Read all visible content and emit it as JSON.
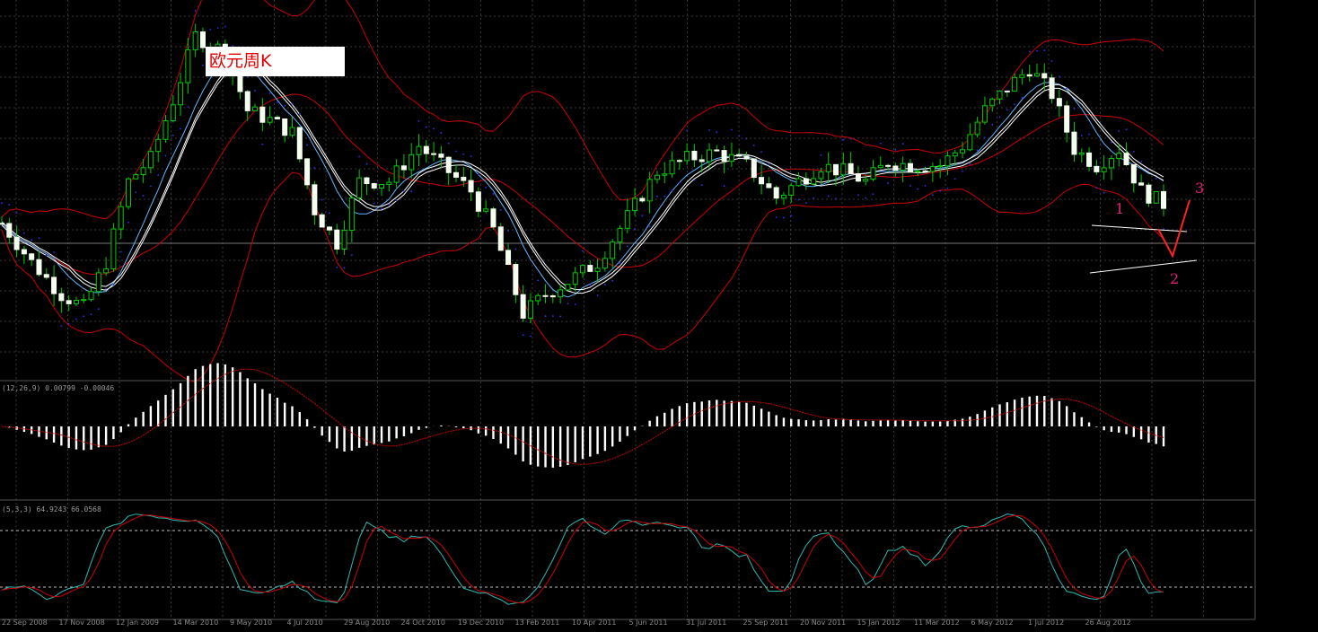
{
  "chart_data": {
    "type": "candlestick",
    "title": "欧元周K",
    "subtitle": "",
    "xlabel": "",
    "ylabel": "",
    "grid": true,
    "x_ticks": [
      "22 Sep 2008",
      "17 Nov 2008",
      "12 Jan 2009",
      "14 Mar 2010",
      "9 May 2010",
      "4 Jul 2010",
      "29 Aug 2010",
      "24 Oct 2010",
      "19 Dec 2010",
      "13 Feb 2011",
      "10 Apr 2011",
      "5 Jun 2011",
      "31 Jul 2011",
      "25 Sep 2011",
      "20 Nov 2011",
      "15 Jan 2012",
      "11 Mar 2012",
      "6 May 2012",
      "1 Jul 2012",
      "26 Aug 2012"
    ],
    "price_path_norm": [
      [
        0,
        0.42
      ],
      [
        4,
        0.3
      ],
      [
        8,
        0.2
      ],
      [
        11,
        0.16
      ],
      [
        14,
        0.3
      ],
      [
        17,
        0.55
      ],
      [
        20,
        0.62
      ],
      [
        23,
        0.8
      ],
      [
        26,
        1.0
      ],
      [
        30,
        0.95
      ],
      [
        33,
        0.77
      ],
      [
        36,
        0.74
      ],
      [
        39,
        0.7
      ],
      [
        42,
        0.46
      ],
      [
        45,
        0.36
      ],
      [
        48,
        0.55
      ],
      [
        52,
        0.55
      ],
      [
        56,
        0.66
      ],
      [
        60,
        0.58
      ],
      [
        63,
        0.52
      ],
      [
        66,
        0.4
      ],
      [
        70,
        0.14
      ],
      [
        73,
        0.2
      ],
      [
        76,
        0.24
      ],
      [
        80,
        0.3
      ],
      [
        84,
        0.44
      ],
      [
        88,
        0.58
      ],
      [
        92,
        0.62
      ],
      [
        96,
        0.64
      ],
      [
        100,
        0.6
      ],
      [
        104,
        0.5
      ],
      [
        107,
        0.55
      ],
      [
        110,
        0.6
      ],
      [
        113,
        0.58
      ],
      [
        116,
        0.55
      ],
      [
        119,
        0.61
      ],
      [
        122,
        0.6
      ],
      [
        126,
        0.6
      ],
      [
        129,
        0.66
      ],
      [
        132,
        0.77
      ],
      [
        135,
        0.84
      ],
      [
        138,
        0.9
      ],
      [
        141,
        0.82
      ],
      [
        144,
        0.65
      ],
      [
        147,
        0.6
      ],
      [
        150,
        0.65
      ],
      [
        153,
        0.52
      ],
      [
        156,
        0.48
      ]
    ],
    "annotations": [
      {
        "label": "1",
        "color": "#e8207a"
      },
      {
        "label": "2",
        "color": "#e8207a"
      },
      {
        "label": "3",
        "color": "#e8207a"
      }
    ],
    "indicators": [
      {
        "name": "MACD",
        "label": "(12,26,9) 0.00799 -0.00046",
        "colors": {
          "histogram": "#ffffff",
          "signal": "#cc0000"
        }
      },
      {
        "name": "Stochastic",
        "label": "(5,3,3) 64.9243 66.0568",
        "levels": [
          80,
          20
        ],
        "colors": {
          "main": "#2fb8b0",
          "signal": "#cc0000"
        }
      }
    ],
    "colors": {
      "background": "#000000",
      "grid": "#3a3a3a",
      "candle_up": "#000000",
      "candle_border": "#00cc00",
      "bands": "#cc0000",
      "ma_fast": "#ffffff",
      "ma_slow": "#5fb5ff",
      "psar": "#3030ff",
      "trendline": "#ffffff"
    }
  }
}
